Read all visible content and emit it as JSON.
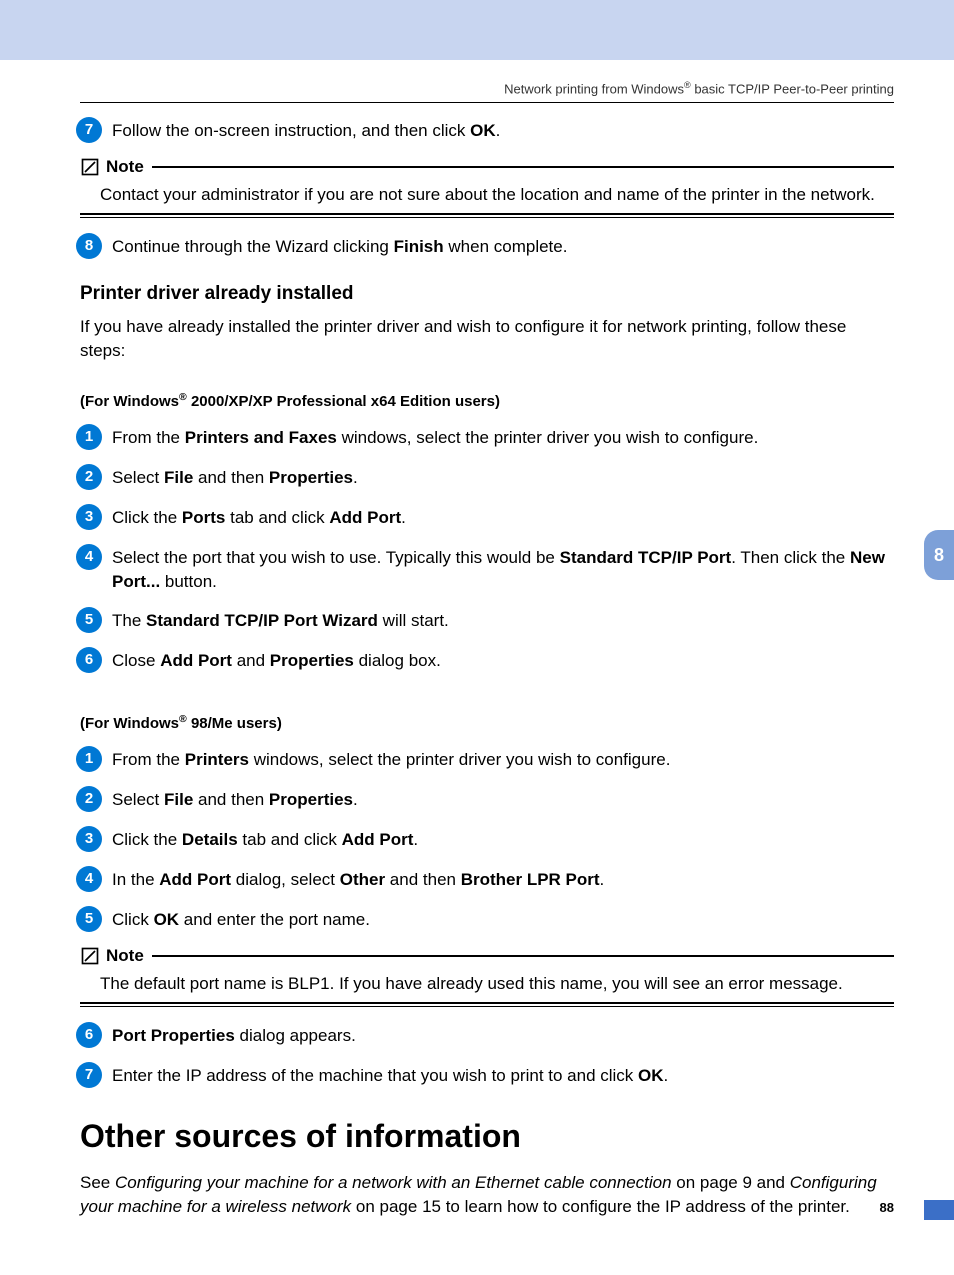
{
  "header": {
    "pre": "Network printing from Windows",
    "sup": "®",
    "post": " basic TCP/IP Peer-to-Peer printing"
  },
  "step7": {
    "num": "7",
    "t1": "Follow the on-screen instruction, and then click ",
    "b1": "OK",
    "t2": "."
  },
  "note1": {
    "label": "Note",
    "body": "Contact your administrator if you are not sure about the location and name of the printer in the network."
  },
  "step8": {
    "num": "8",
    "t1": "Continue through the Wizard clicking ",
    "b1": "Finish",
    "t2": " when complete."
  },
  "already": {
    "title": "Printer driver already installed",
    "intro": "If you have already installed the printer driver and wish to configure it for network printing, follow these steps:"
  },
  "sub1": {
    "pre": "(For Windows",
    "sup": "®",
    "post": " 2000/XP/XP Professional x64 Edition users)"
  },
  "s1": {
    "a": {
      "num": "1",
      "t1": "From the ",
      "b1": "Printers and Faxes",
      "t2": " windows, select the printer driver you wish to configure."
    },
    "b": {
      "num": "2",
      "t1": "Select ",
      "b1": "File",
      "t2": " and then ",
      "b2": "Properties",
      "t3": "."
    },
    "c": {
      "num": "3",
      "t1": "Click the ",
      "b1": "Ports",
      "t2": " tab and click ",
      "b2": "Add Port",
      "t3": "."
    },
    "d": {
      "num": "4",
      "t1": "Select the port that you wish to use. Typically this would be ",
      "b1": "Standard TCP/IP Port",
      "t2": ". Then click the ",
      "b2": "New Port...",
      "t3": " button."
    },
    "e": {
      "num": "5",
      "t1": "The ",
      "b1": "Standard TCP/IP Port Wizard",
      "t2": " will start."
    },
    "f": {
      "num": "6",
      "t1": "Close ",
      "b1": "Add Port",
      "t2": " and ",
      "b2": "Properties",
      "t3": " dialog box."
    }
  },
  "sub2": {
    "pre": "(For Windows",
    "sup": "®",
    "post": " 98/Me users)"
  },
  "s2": {
    "a": {
      "num": "1",
      "t1": "From the ",
      "b1": "Printers",
      "t2": " windows, select the printer driver you wish to configure."
    },
    "b": {
      "num": "2",
      "t1": "Select ",
      "b1": "File",
      "t2": " and then ",
      "b2": "Properties",
      "t3": "."
    },
    "c": {
      "num": "3",
      "t1": "Click the ",
      "b1": "Details",
      "t2": " tab and click ",
      "b2": "Add Port",
      "t3": "."
    },
    "d": {
      "num": "4",
      "t1": "In the ",
      "b1": "Add Port",
      "t2": " dialog, select ",
      "b2": "Other",
      "t3": " and then ",
      "b3": "Brother LPR Port",
      "t4": "."
    },
    "e": {
      "num": "5",
      "t1": "Click ",
      "b1": "OK",
      "t2": " and enter the port name."
    }
  },
  "note2": {
    "label": "Note",
    "body": "The default port name is BLP1. If you have already used this name, you will see an error message."
  },
  "s2b": {
    "f": {
      "num": "6",
      "b1": "Port Properties",
      "t2": " dialog appears."
    },
    "g": {
      "num": "7",
      "t1": "Enter the IP address of the machine that you wish to print to and click ",
      "b1": "OK",
      "t2": "."
    }
  },
  "other": {
    "title": "Other sources of information",
    "t1": "See ",
    "i1": "Configuring your machine for a network with an Ethernet cable connection",
    "t2": " on page 9 and ",
    "i2": "Configuring your machine for a wireless network",
    "t3": " on page 15 to learn how to configure the IP address of the printer."
  },
  "tab": "8",
  "page_number": "88"
}
